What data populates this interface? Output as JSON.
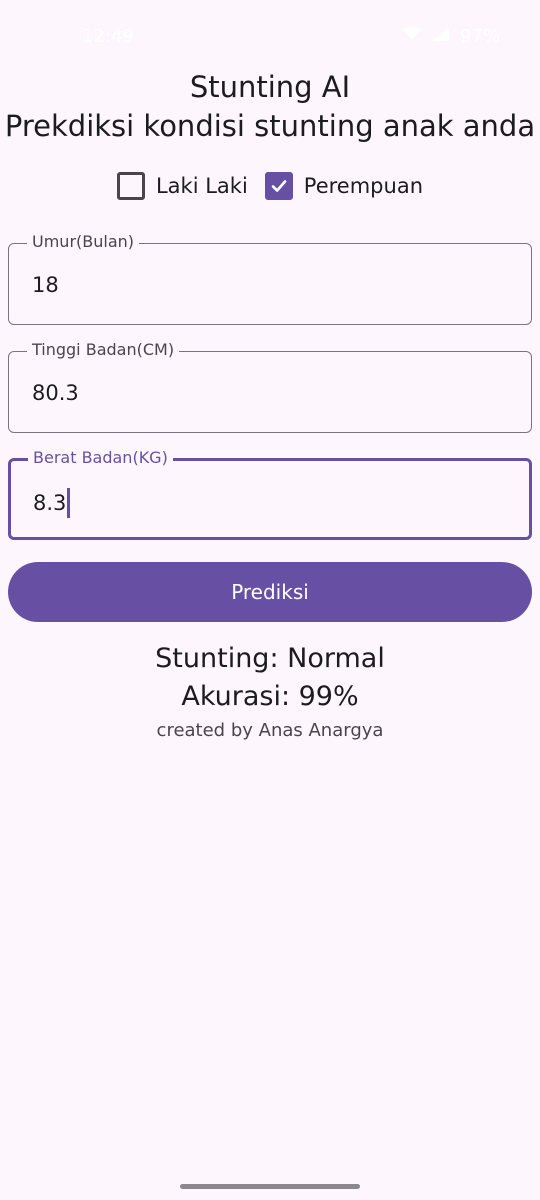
{
  "status_bar": {
    "time": "12:49",
    "battery": "97%"
  },
  "header": {
    "title": "Stunting AI",
    "subtitle": "Prekdiksi kondisi stunting anak anda"
  },
  "gender": {
    "male_label": "Laki Laki",
    "male_checked": false,
    "female_label": "Perempuan",
    "female_checked": true
  },
  "form": {
    "age": {
      "label": "Umur(Bulan)",
      "value": "18"
    },
    "height": {
      "label": "Tinggi Badan(CM)",
      "value": "80.3"
    },
    "weight": {
      "label": "Berat Badan(KG)",
      "value": "8.3"
    }
  },
  "predict_button_label": "Prediksi",
  "result": {
    "status": "Stunting: Normal",
    "accuracy": "Akurasi: 99%",
    "credit": "created by Anas Anargya"
  },
  "colors": {
    "accent": "#6750a4",
    "background": "#fdf7fd",
    "outline": "#79747e"
  },
  "icons": [
    "check-icon",
    "wifi-icon",
    "signal-icon",
    "battery-icon"
  ]
}
